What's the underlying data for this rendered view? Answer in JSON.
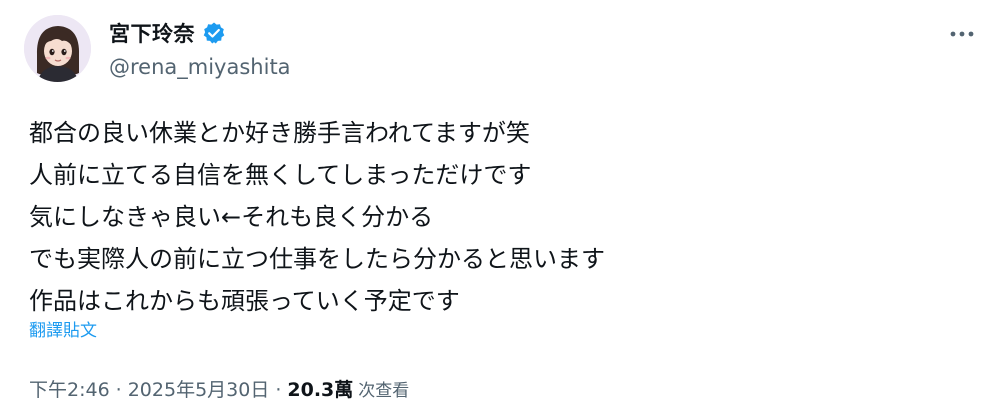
{
  "author": {
    "display_name": "宮下玲奈",
    "handle": "@rena_miyashita",
    "verified": true,
    "verified_color": "#1d9bf0"
  },
  "tweet": {
    "lines": [
      "都合の良い休業とか好き勝手言われてますが笑",
      "人前に立てる自信を無くしてしまっただけです",
      "気にしなきゃ良い←それも良く分かる",
      "でも実際人の前に立つ仕事をしたら分かると思います",
      "作品はこれからも頑張っていく予定です"
    ],
    "translate_label": "翻譯貼文"
  },
  "meta": {
    "time": "下午2:46",
    "separator": "·",
    "date": "2025年5月30日",
    "views_count": "20.3萬",
    "views_label": "次查看"
  },
  "colors": {
    "text": "#0f1419",
    "secondary": "#536471",
    "link": "#1d9bf0"
  },
  "icons": {
    "more": "more-horizontal-icon",
    "verified": "verified-badge-icon"
  }
}
